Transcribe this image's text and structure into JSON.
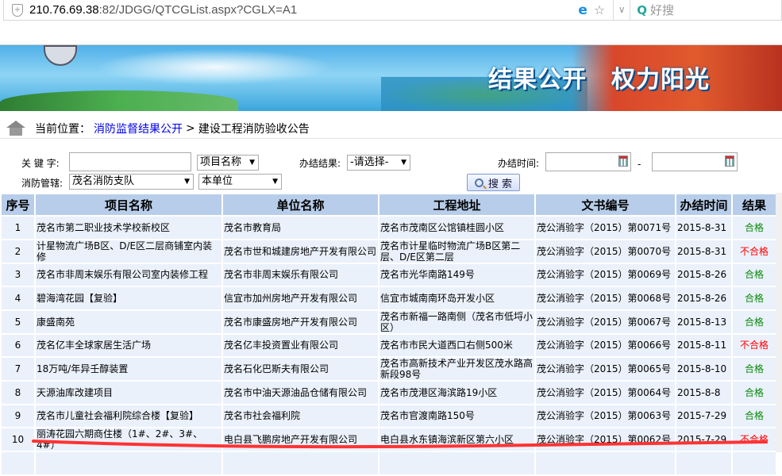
{
  "browser": {
    "url_host": "210.76.69.38",
    "url_rest": ":82/JDGG/QTCGList.aspx?CGLX=A1",
    "search_placeholder": "好搜"
  },
  "banner": {
    "slogan": "结果公开　权力阳光"
  },
  "breadcrumb": {
    "label": "当前位置：",
    "link": "消防监督结果公开",
    "sep": ">",
    "current": "建设工程消防验收公告"
  },
  "filters": {
    "keyword_label": "关 键 字:",
    "keyword_value": "",
    "keyword_field": "项目名称",
    "result_label": "办结结果:",
    "result_value": "-请选择-",
    "date_label": "办结时间:",
    "date_sep": "-",
    "date_from": "",
    "date_to": "",
    "dept_label": "消防管辖:",
    "dept_value": "茂名消防支队",
    "scope_value": "本单位",
    "search_button": "搜 索"
  },
  "table": {
    "headers": [
      "序号",
      "项目名称",
      "单位名称",
      "工程地址",
      "文书编号",
      "办结时间",
      "结果"
    ],
    "rows": [
      [
        "1",
        "茂名市第二职业技术学校新校区",
        "茂名市教育局",
        "茂名市茂南区公馆镇桂圆小区",
        "茂公消验字（2015）第0071号",
        "2015-8-31",
        "合格"
      ],
      [
        "2",
        "计星物流广场B区、D/E区二层商铺室内装修",
        "茂名市世和城建房地产开发有限公司",
        "茂名市计星临时物流广场B区第二层、D/E区第二层",
        "茂公消验字（2015）第0070号",
        "2015-8-31",
        "不合格"
      ],
      [
        "3",
        "茂名市非周末娱乐有限公司室内装修工程",
        "茂名市非周末娱乐有限公司",
        "茂名市光华南路149号",
        "茂公消验字（2015）第0069号",
        "2015-8-26",
        "合格"
      ],
      [
        "4",
        "碧海湾花园【复验】",
        "信宜市加州房地产开发有限公司",
        "信宜市城南南环岛开发小区",
        "茂公消验字（2015）第0068号",
        "2015-8-26",
        "合格"
      ],
      [
        "5",
        "康盛南苑",
        "茂名市康盛房地产开发有限公司",
        "茂名市新福一路南侧（茂名市低埒小区）",
        "茂公消验字（2015）第0067号",
        "2015-8-13",
        "合格"
      ],
      [
        "6",
        "茂名亿丰全球家居生活广场",
        "茂名亿丰投资置业有限公司",
        "茂名市市民大道西口右侧500米",
        "茂公消验字（2015）第0066号",
        "2015-8-11",
        "不合格"
      ],
      [
        "7",
        "18万吨/年异壬醇装置",
        "茂名石化巴斯夫有限公司",
        "茂名市高新技术产业开发区茂水路高新段98号",
        "茂公消验字（2015）第0065号",
        "2015-8-10",
        "合格"
      ],
      [
        "8",
        "天源油库改建项目",
        "茂名市中油天源油品仓储有限公司",
        "茂名市茂港区海滨路19小区",
        "茂公消验字（2015）第0064号",
        "2015-8-8",
        "合格"
      ],
      [
        "9",
        "茂名市儿童社会福利院综合楼【复验】",
        "茂名市社会福利院",
        "茂名市官渡南路150号",
        "茂公消验字（2015）第0063号",
        "2015-7-29",
        "合格"
      ],
      [
        "10",
        "丽涛花园六期商住楼（1#、2#、3#、4#）",
        "电白县飞鹏房地产开发有限公司",
        "电白县水东镇海滨新区第六小区",
        "茂公消验字（2015）第0062号",
        "2015-7-29",
        "不合格"
      ]
    ]
  },
  "colors": {
    "pass": "#0a8a0a",
    "fail": "#ff0000",
    "header_bg": "#b7cde9",
    "row_bg": "#eaf1fb",
    "annotation": "#ff3333"
  },
  "icons": {
    "home": "house-icon",
    "calendar": "calendar-icon",
    "search": "magnifier-icon"
  }
}
